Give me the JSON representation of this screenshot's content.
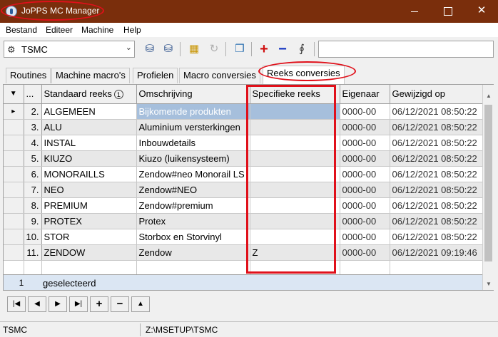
{
  "window": {
    "title": "JoPPS MC Manager"
  },
  "menu": [
    "Bestand",
    "Editeer",
    "Machine",
    "Help"
  ],
  "toolbar": {
    "machine_select": "TSMC",
    "search_value": ""
  },
  "tabs": [
    {
      "label": "Routines",
      "active": false
    },
    {
      "label": "Machine macro's",
      "active": false
    },
    {
      "label": "Profielen",
      "active": false
    },
    {
      "label": "Macro conversies",
      "active": false
    },
    {
      "label": "Reeks conversies",
      "active": true
    }
  ],
  "grid": {
    "columns": {
      "nr": "...",
      "standard": "Standaard reeks",
      "sort_badge": "1",
      "description": "Omschrijving",
      "specific": "Specifieke reeks",
      "owner": "Eigenaar",
      "modified": "Gewijzigd op"
    },
    "rows": [
      {
        "nr": "2.",
        "standard": "ALGEMEEN",
        "description": "Bijkomende produkten",
        "specific": "",
        "owner": "0000-00",
        "modified": "06/12/2021 08:50:22"
      },
      {
        "nr": "3.",
        "standard": "ALU",
        "description": "Aluminium versterkingen",
        "specific": "",
        "owner": "0000-00",
        "modified": "06/12/2021 08:50:22"
      },
      {
        "nr": "4.",
        "standard": "INSTAL",
        "description": "Inbouwdetails",
        "specific": "",
        "owner": "0000-00",
        "modified": "06/12/2021 08:50:22"
      },
      {
        "nr": "5.",
        "standard": "KIUZO",
        "description": "Kiuzo (luikensysteem)",
        "specific": "",
        "owner": "0000-00",
        "modified": "06/12/2021 08:50:22"
      },
      {
        "nr": "6.",
        "standard": "MONORAILLS",
        "description": "Zendow#neo Monorail LS",
        "specific": "",
        "owner": "0000-00",
        "modified": "06/12/2021 08:50:22"
      },
      {
        "nr": "7.",
        "standard": "NEO",
        "description": "Zendow#NEO",
        "specific": "",
        "owner": "0000-00",
        "modified": "06/12/2021 08:50:22"
      },
      {
        "nr": "8.",
        "standard": "PREMIUM",
        "description": "Zendow#premium",
        "specific": "",
        "owner": "0000-00",
        "modified": "06/12/2021 08:50:22"
      },
      {
        "nr": "9.",
        "standard": "PROTEX",
        "description": "Protex",
        "specific": "",
        "owner": "0000-00",
        "modified": "06/12/2021 08:50:22"
      },
      {
        "nr": "10.",
        "standard": "STOR",
        "description": "Storbox en Storvinyl",
        "specific": "",
        "owner": "0000-00",
        "modified": "06/12/2021 08:50:22"
      },
      {
        "nr": "11.",
        "standard": "ZENDOW",
        "description": "Zendow",
        "specific": "Z",
        "owner": "0000-00",
        "modified": "06/12/2021 09:19:46"
      }
    ],
    "footer_count": "1",
    "footer_label": "geselecteerd"
  },
  "status": {
    "left": "TSMC",
    "path": "Z:\\MSETUP\\TSMC"
  },
  "colors": {
    "titlebar": "#7a2e0c",
    "highlight": "#e0101a",
    "selection": "#a6bfdc"
  }
}
